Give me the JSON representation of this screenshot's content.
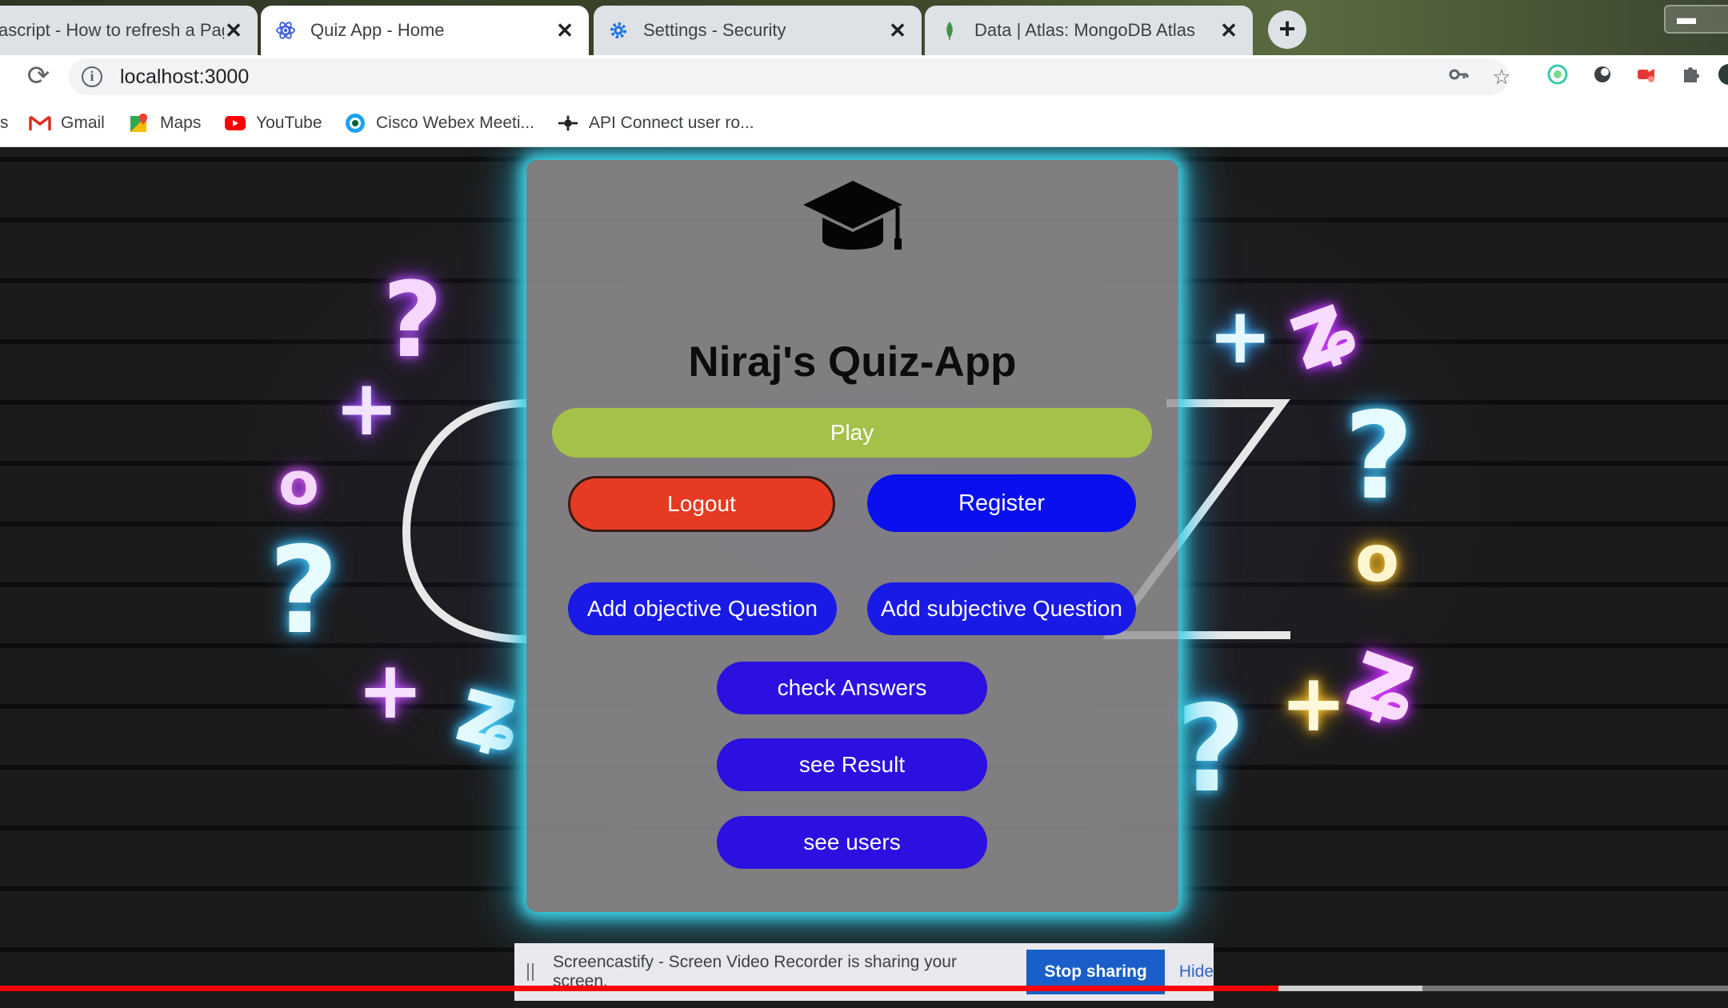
{
  "browser": {
    "tabs": [
      {
        "title": "ascript - How to refresh a Pag",
        "icon": "stackoverflow-icon",
        "active": false
      },
      {
        "title": "Quiz App - Home",
        "icon": "react-icon",
        "active": true
      },
      {
        "title": "Settings - Security",
        "icon": "gear-icon",
        "active": false
      },
      {
        "title": "Data | Atlas: MongoDB Atlas",
        "icon": "mongodb-leaf-icon",
        "active": false
      }
    ],
    "new_tab_label": "+",
    "url": "localhost:3000",
    "bookmarks": [
      {
        "label": "s",
        "icon": "none"
      },
      {
        "label": "Gmail",
        "icon": "gmail-icon"
      },
      {
        "label": "Maps",
        "icon": "maps-icon"
      },
      {
        "label": "YouTube",
        "icon": "youtube-icon"
      },
      {
        "label": "Cisco Webex Meeti...",
        "icon": "webex-icon"
      },
      {
        "label": "API Connect user ro...",
        "icon": "api-connect-icon"
      }
    ]
  },
  "app": {
    "title": "Niraj's Quiz-App",
    "buttons": {
      "play": "Play",
      "logout": "Logout",
      "register": "Register",
      "add_objective": "Add objective Question",
      "add_subjective": "Add subjective Question",
      "check_answers": "check Answers",
      "see_result": "see Result",
      "see_users": "see users"
    },
    "colors": {
      "play": "#a4c24a",
      "logout": "#e63a22",
      "register": "#0a0ff0",
      "primary": "#2b10df",
      "card_glow": "#3fd7ea"
    }
  },
  "screencastify": {
    "message": "Screencastify - Screen Video Recorder is sharing your screen.",
    "stop_label": "Stop sharing",
    "hide_label": "Hide"
  },
  "video_progress": 0.74
}
